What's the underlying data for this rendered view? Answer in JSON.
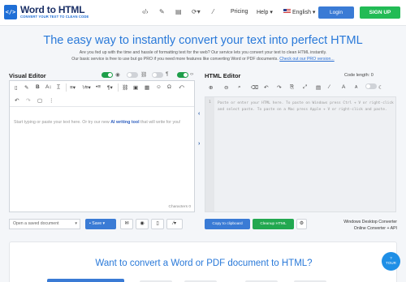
{
  "brand": {
    "logo_glyph": "</>",
    "name": "Word to HTML",
    "tagline": "CONVERT YOUR TEXT TO CLEAN CODE"
  },
  "nav": {
    "icons": [
      "code-icon",
      "edit-icon",
      "document-icon",
      "sync-icon",
      "magic-wand-icon"
    ],
    "pricing": "Pricing",
    "help": "Help ▾",
    "language": "English ▾",
    "login": "Login",
    "signup": "SIGN UP"
  },
  "hero": {
    "title": "The easy way to instantly convert your text into perfect HTML",
    "line1": "Are you fed up with the time and hassle of formatting text for the web? Our service lets you convert your text to clean HTML instantly.",
    "line2": "Our basic service is free to use but go PRO if you need more features like converting Word or PDF documents.",
    "pro_link": "Check out our PRO version..."
  },
  "visual_editor": {
    "label": "Visual Editor",
    "placeholder_before": "Start typing or paste your text here. Or try our new ",
    "placeholder_link": "AI writing tool",
    "placeholder_after": " that will write for you!",
    "characters_label": "Characters",
    "characters_value": "0"
  },
  "html_editor": {
    "label": "HTML Editor",
    "code_length_label": "Code length:",
    "code_length_value": "0",
    "line_number": "1",
    "placeholder": "Paste or enter your HTML here. To paste on Windows press Ctrl + V or right-click and select paste. To paste on a Mac press Apple + V or right-click and paste."
  },
  "controls": {
    "saved_doc_placeholder": "Open a saved document",
    "save": "Save ▾",
    "copy": "Copy to clipboard",
    "cleanup": "Cleanup HTML",
    "windows_converter": "Windows Desktop Converter",
    "online_converter": "Online Converter + API"
  },
  "bottom": {
    "title": "Want to convert a Word or PDF document to HTML?",
    "help_label": "TOUR"
  },
  "colors": {
    "accent": "#2979d9",
    "primary_button": "#3a7bd5",
    "success": "#22bb55",
    "brand_dark": "#1a2f66"
  }
}
